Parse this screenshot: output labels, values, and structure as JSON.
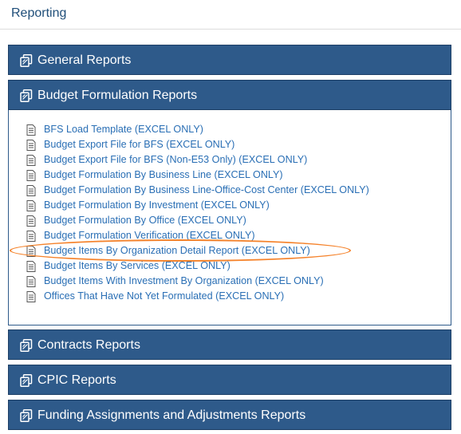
{
  "page": {
    "title": "Reporting"
  },
  "panels": [
    {
      "label": "General Reports"
    },
    {
      "label": "Budget Formulation Reports"
    },
    {
      "label": "Contracts Reports"
    },
    {
      "label": "CPIC Reports"
    },
    {
      "label": "Funding Assignments and Adjustments Reports"
    }
  ],
  "budget_reports": [
    "BFS Load Template (EXCEL ONLY)",
    "Budget Export File for BFS (EXCEL ONLY)",
    "Budget Export File for BFS (Non-E53 Only) (EXCEL ONLY)",
    "Budget Formulation By Business Line (EXCEL ONLY)",
    "Budget Formulation By Business Line-Office-Cost Center (EXCEL ONLY)",
    "Budget Formulation By Investment (EXCEL ONLY)",
    "Budget Formulation By Office (EXCEL ONLY)",
    "Budget Formulation Verification (EXCEL ONLY)",
    "Budget Items By Organization Detail Report (EXCEL ONLY)",
    "Budget Items By Services (EXCEL ONLY)",
    "Budget Items With Investment By Organization (EXCEL ONLY)",
    "Offices That Have Not Yet Formulated (EXCEL ONLY)"
  ],
  "icons": {
    "panel": "copy-icon",
    "report": "document-icon"
  },
  "colors": {
    "panel_bg": "#2e5a8a",
    "link": "#2a6fb5",
    "title": "#1f4e79",
    "highlight": "#f5822a"
  },
  "highlighted_item": "Budget Items By Organization Detail Report (EXCEL ONLY)"
}
